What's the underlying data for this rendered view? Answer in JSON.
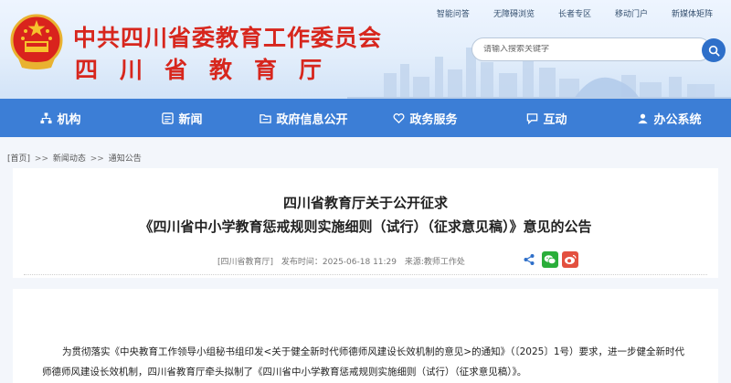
{
  "header": {
    "org_name": "中共四川省委教育工作委员会",
    "dept_name": "四川省教育厅",
    "top_links": [
      "智能问答",
      "无障碍浏览",
      "长者专区",
      "移动门户",
      "新媒体矩阵"
    ],
    "search": {
      "placeholder": "请输入搜索关键字",
      "icon": "search-icon"
    }
  },
  "nav": {
    "items": [
      {
        "label": "机构",
        "icon": "org-chart-icon"
      },
      {
        "label": "新闻",
        "icon": "news-icon"
      },
      {
        "label": "政府信息公开",
        "icon": "info-folder-icon"
      },
      {
        "label": "政务服务",
        "icon": "heart-hand-icon"
      },
      {
        "label": "互动",
        "icon": "chat-icon"
      },
      {
        "label": "办公系统",
        "icon": "people-icon"
      }
    ],
    "colors": {
      "bar": "#3c7ed6",
      "text": "#ffffff"
    }
  },
  "breadcrumb": {
    "items": [
      "[首页]",
      "新闻动态",
      "通知公告"
    ],
    "separator": ">>"
  },
  "article": {
    "title_line1": "四川省教育厅关于公开征求",
    "title_line2": "《四川省中小学教育惩戒规则实施细则（试行）（征求意见稿）》意见的公告",
    "publisher": "[四川省教育厅]",
    "published": "发布时间：2025-06-18 11:29",
    "source": "来源:教师工作处",
    "share_icons": [
      "share-icon",
      "wechat-icon",
      "weibo-icon"
    ],
    "body": "为贯彻落实《中央教育工作领导小组秘书组印发<关于健全新时代师德师风建设长效机制的意见>的通知》（〔2025〕1号）要求，进一步健全新时代师德师风建设长效机制，四川省教育厅牵头拟制了《四川省中小学教育惩戒规则实施细则（试行）（征求意见稿）》。"
  },
  "colors": {
    "accent_red": "#d7261d",
    "nav_blue": "#3c7ed6",
    "background": "#f3f6fb"
  }
}
